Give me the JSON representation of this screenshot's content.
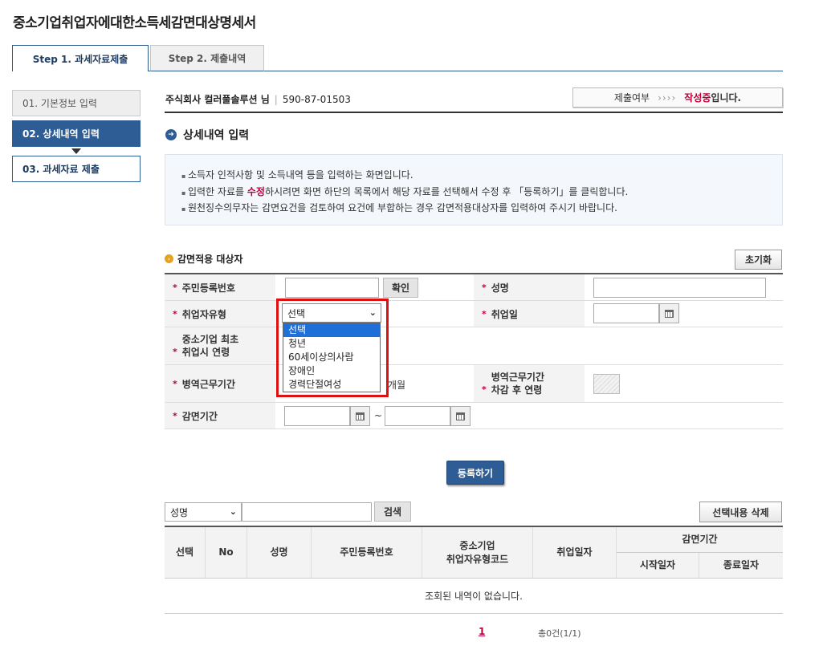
{
  "page_title": "중소기업취업자에대한소득세감면대상명세서",
  "tabs": [
    {
      "label": "Step 1. 과세자료제출",
      "active": true
    },
    {
      "label": "Step 2. 제출내역",
      "active": false
    }
  ],
  "side_steps": [
    {
      "label": "01. 기본정보 입력",
      "state": "done"
    },
    {
      "label": "02. 상세내역 입력",
      "state": "active"
    },
    {
      "label": "03. 과세자료 제출",
      "state": "next"
    }
  ],
  "company": {
    "name": "주식회사 컬러풀솔루션 님",
    "reg_no": "590-87-01503"
  },
  "status": {
    "label": "제출여부",
    "arrows": "››››",
    "state_red": "작성중",
    "state_suffix": "입니다."
  },
  "section_title": "상세내역 입력",
  "info_lines": {
    "line1": "소득자 인적사항 및 소득내역 등을 입력하는 화면입니다.",
    "line2_a": "입력한 자료를 ",
    "line2_red": "수정",
    "line2_b": "하시려면 화면 하단의 목록에서 해당 자료를 선택해서 수정 후 「등록하기」를 클릭합니다.",
    "line3": "원천징수의무자는 감면요건을 검토하여 요건에 부합하는 경우 감면적용대상자를 입력하여 주시기 바랍니다."
  },
  "subsection_title": "감면적용 대상자",
  "reset_button": "초기화",
  "form": {
    "ssn_label": "주민등록번호",
    "confirm_button": "확인",
    "name_label": "성명",
    "type_label": "취업자유형",
    "type_selected": "선택",
    "type_options": [
      "선택",
      "청년",
      "60세이상의사람",
      "장애인",
      "경력단절여성"
    ],
    "hire_date_label": "취업일",
    "first_age_label_1": "중소기업 최초",
    "first_age_label_2": "취업시 연령",
    "military_label": "병역근무기간",
    "military_unit": "개월",
    "military_age_label_1": "병역근무기간",
    "military_age_label_2": "차감 후 연령",
    "reduction_label": "감면기간",
    "tilde": "~",
    "required_mark": "*"
  },
  "register_button": "등록하기",
  "search": {
    "field_selected": "성명",
    "button": "검색",
    "delete_button": "선택내용 삭제"
  },
  "list": {
    "headers": {
      "select": "선택",
      "no": "No",
      "name": "성명",
      "ssn": "주민등록번호",
      "type_code_1": "중소기업",
      "type_code_2": "취업자유형코드",
      "hire_date": "취업일자",
      "period": "감면기간",
      "start": "시작일자",
      "end": "종료일자"
    },
    "empty_message": "조회된 내역이 없습니다."
  },
  "pagination": {
    "current": "1",
    "total": "총0건(1/1)"
  }
}
